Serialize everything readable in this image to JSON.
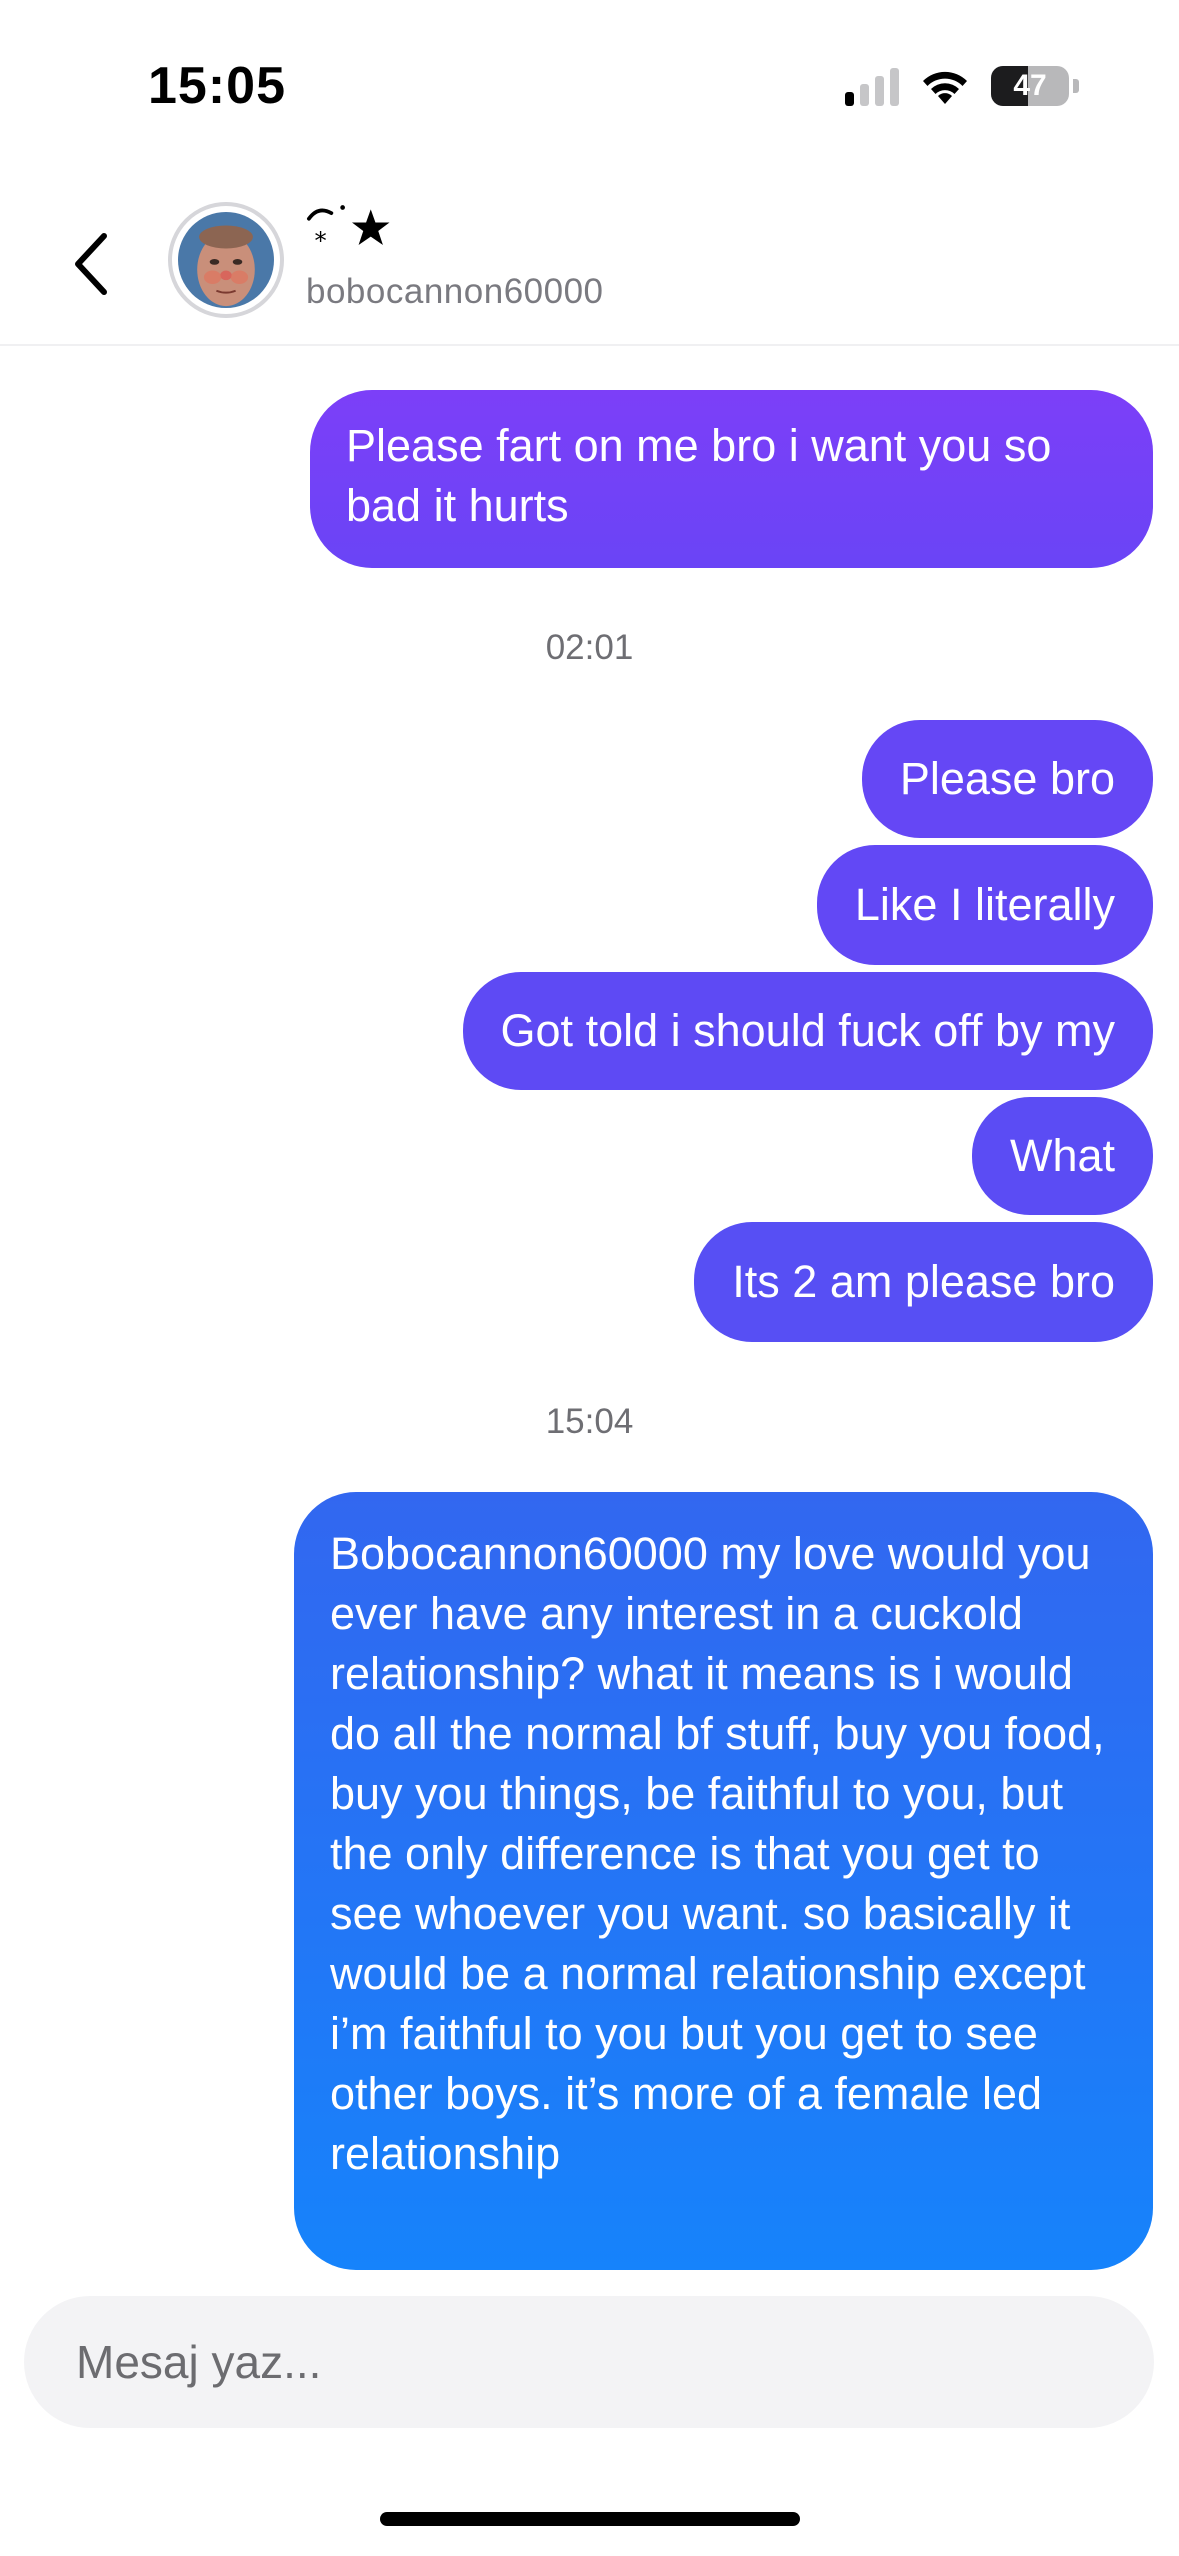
{
  "status_bar": {
    "time": "15:05",
    "battery_level": "47",
    "signal_bars_active": 1,
    "signal_bars_total": 4,
    "icons": [
      "cellular-signal-icon",
      "wifi-icon",
      "battery-icon"
    ]
  },
  "header": {
    "back_icon": "chevron-left-icon",
    "avatar": "avatar",
    "display_name_icon": "star-emoticon-icon",
    "username": "bobocannon60000"
  },
  "colors": {
    "bubble_purple_top": "#7c3ff8",
    "bubble_purple_bottom": "#6a44f6",
    "bubble_indigo": "#5b4cf3",
    "bubble_blue_top": "#3267f0",
    "bubble_blue_bottom": "#1683fb"
  },
  "messages": {
    "m1": "Please fart on me bro i want you so bad it hurts",
    "ts1": "02:01",
    "m2": "Please bro",
    "m3": "Like I literally",
    "m4": "Got told i should fuck off by my",
    "m5": "What",
    "m6": "Its 2 am please bro",
    "ts2": "15:04",
    "m7": "Bobocannon60000 my love would you ever have any interest in a cuckold relationship? what it means is i would do all the normal bf stuff, buy you food, buy you things, be faithful to you, but the only difference is that you get to see whoever you want. so basically it would be a normal relationship except i’m faithful to you but you get to see other boys. it’s more of a female led relationship"
  },
  "composer": {
    "placeholder": "Mesaj yaz..."
  }
}
